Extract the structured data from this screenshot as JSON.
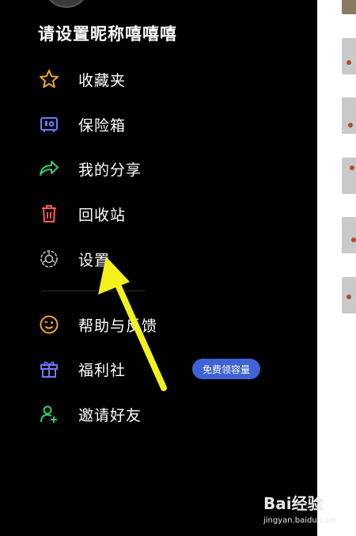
{
  "profile": {
    "nickname": "请设置昵称嘻嘻嘻"
  },
  "menu": [
    {
      "label": "收藏夹",
      "icon": "star-icon",
      "color": "#f5a623"
    },
    {
      "label": "保险箱",
      "icon": "safe-box-icon",
      "color": "#6b7cff"
    },
    {
      "label": "我的分享",
      "icon": "share-icon",
      "color": "#2ecc71"
    },
    {
      "label": "回收站",
      "icon": "trash-icon",
      "color": "#ff5a4e"
    },
    {
      "label": "设置",
      "icon": "gear-icon",
      "color": "#bdbdbd"
    }
  ],
  "menu2": [
    {
      "label": "帮助与反馈",
      "icon": "smile-wink-icon",
      "color": "#f5a623"
    },
    {
      "label": "福利社",
      "icon": "gift-icon",
      "color": "#6b7cff",
      "badge": "免费领容量"
    },
    {
      "label": "邀请好友",
      "icon": "add-user-icon",
      "color": "#2ecc71"
    }
  ],
  "annotation": {
    "arrow_color": "#f4f11d"
  },
  "watermark": {
    "main": "Bai经验",
    "sub": "jingyan.baidu.com"
  }
}
